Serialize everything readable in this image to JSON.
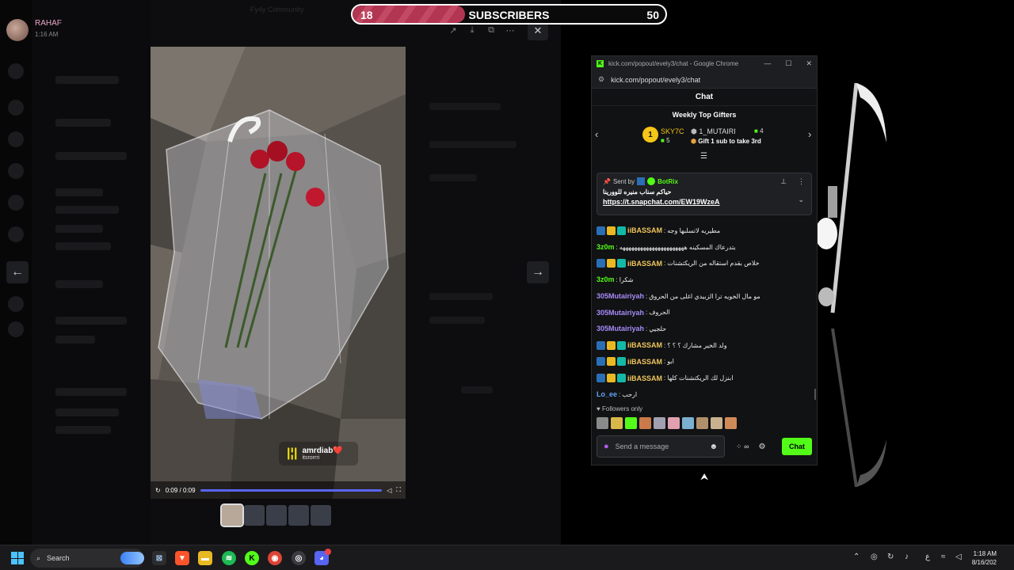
{
  "subs_bar": {
    "current": "18",
    "label": "SUBSCRIBERS",
    "goal": "50",
    "progress": 0.36
  },
  "discord": {
    "streamer_name": "RAHAF",
    "streamer_time": "1:16 AM",
    "ghost_title": "Fy4y Community",
    "music_title": "amrdiab❤️",
    "music_sub": "itsrorrri",
    "video_time": "0:09 / 0:09"
  },
  "chrome": {
    "title": "kick.com/popout/evely3/chat - Google Chrome",
    "url": "kick.com/popout/evely3/chat"
  },
  "chat": {
    "header": "Chat",
    "gifters_title": "Weekly Top Gifters",
    "gifter1_name": "SKY7C",
    "gifter1_count": "5",
    "gifter2_name": "1_MUTAIRI",
    "gifter2_count": "4",
    "gift_cta": "Gift 1 sub to take 3rd",
    "pinned": {
      "sent_by": "Sent by",
      "bot_name": "BotRix",
      "message": "حياكم سناب منيره للوورينا",
      "link": "https://t.snapchat.com/EW19WzeA"
    },
    "messages": [
      {
        "user": "iiBASSAM",
        "color": "#f0c75e",
        "badges": true,
        "text": "مطيريه لاتسلبها وجه"
      },
      {
        "user": "3z0m",
        "color": "#53fc18",
        "badges": false,
        "text": "بتدرعاك المسكينه ههههههههههههههههههههههه"
      },
      {
        "user": "iiBASSAM",
        "color": "#f0c75e",
        "badges": true,
        "text": "خلاص بقدم استقاله من الريكتشنات"
      },
      {
        "user": "3z0m",
        "color": "#53fc18",
        "badges": false,
        "text": "شكرا"
      },
      {
        "user": "305Mutairiyah",
        "color": "#a78bfa",
        "badges": false,
        "text": "مو مال الخويه ترا الزبيدي اغلى من الحروق"
      },
      {
        "user": "305Mutairiyah",
        "color": "#a78bfa",
        "badges": false,
        "text": "الحروف"
      },
      {
        "user": "305Mutairiyah",
        "color": "#a78bfa",
        "badges": false,
        "text": "حلجيي"
      },
      {
        "user": "iiBASSAM",
        "color": "#f0c75e",
        "badges": true,
        "text": "ولد الخير مشارك ؟ ؟ ؟"
      },
      {
        "user": "iiBASSAM",
        "color": "#f0c75e",
        "badges": true,
        "text": "ابو"
      },
      {
        "user": "iiBASSAM",
        "color": "#f0c75e",
        "badges": true,
        "text": "ابنزل لك الريكتشنات كلها"
      },
      {
        "user": "Lo_ee",
        "color": "#60a5fa",
        "badges": false,
        "text": "ارحب"
      }
    ],
    "followers_only": "Followers only",
    "input_placeholder": "Send a message",
    "points_icon": "∞",
    "send_label": "Chat"
  },
  "taskbar": {
    "search_label": "Search",
    "time": "1:18 AM",
    "date": "8/16/202",
    "lang": "ع"
  },
  "colors": {
    "kick_green": "#53fc18",
    "subs_fill": "#b23552",
    "discord_blurple": "#5865f2"
  }
}
